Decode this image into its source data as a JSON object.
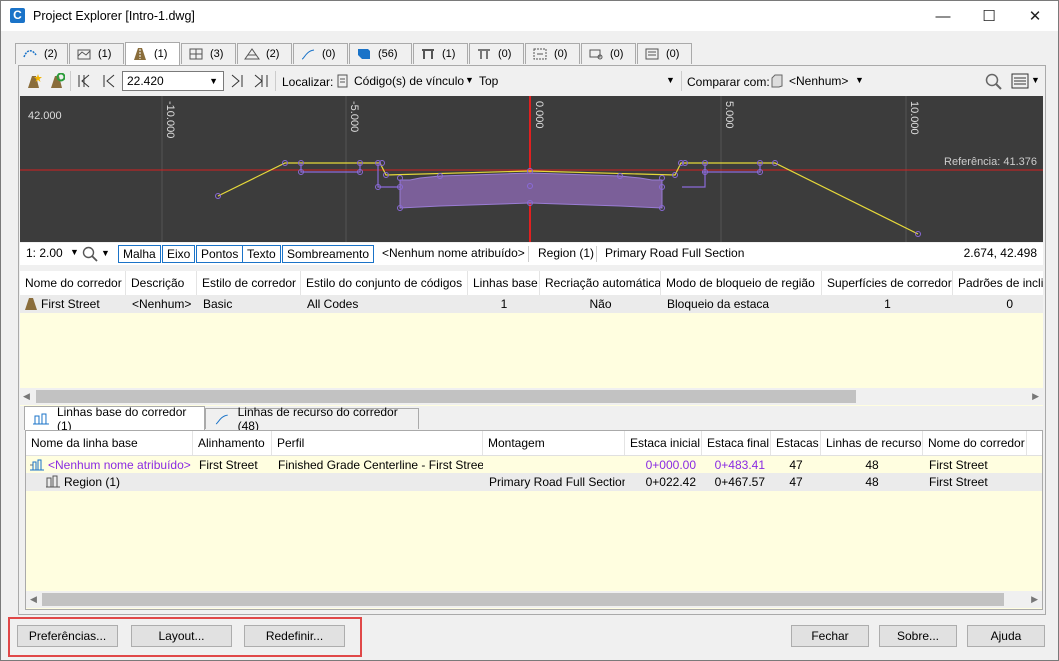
{
  "window": {
    "title": "Project Explorer [Intro-1.dwg]",
    "app_icon": "C"
  },
  "tabs": [
    {
      "icon": "alignment-icon",
      "count": "(2)"
    },
    {
      "icon": "profile-view-icon",
      "count": "(1)"
    },
    {
      "icon": "corridor-icon",
      "count": "(1)"
    },
    {
      "icon": "assembly-icon",
      "count": "(3)"
    },
    {
      "icon": "surface-icon",
      "count": "(2)"
    },
    {
      "icon": "feature-line-icon",
      "count": "(0)"
    },
    {
      "icon": "point-icon",
      "count": "(56)"
    },
    {
      "icon": "pipe-network-icon",
      "count": "(1)"
    },
    {
      "icon": "pressure-network-icon",
      "count": "(0)"
    },
    {
      "icon": "sample-line-icon",
      "count": "(0)"
    },
    {
      "icon": "parcel-icon",
      "count": "(0)"
    },
    {
      "icon": "intersection-icon",
      "count": "(0)"
    }
  ],
  "toolbar": {
    "station": "22.420",
    "localizar_label": "Localizar:",
    "localizar_value": "Código(s) de vínculo",
    "top_value": "Top",
    "comparar_label": "Comparar com:",
    "comparar_value": "<Nenhum>"
  },
  "canvas": {
    "left_label": "42.000",
    "ticks": [
      "-10.000",
      "-5.000",
      "0.000",
      "5.000",
      "10.000"
    ],
    "referencia": "Referência: 41.376"
  },
  "viewbar": {
    "scale": "1: 2.00",
    "toggles": [
      "Malha",
      "Eixo",
      "Pontos",
      "Texto",
      "Sombreamento"
    ],
    "name": "<Nenhum nome atribuído>",
    "region": "Region (1)",
    "section": "Primary Road Full Section",
    "coords": "2.674, 42.498"
  },
  "corridor_grid": {
    "headers": [
      "Nome do corredor",
      "Descrição",
      "Estilo de corredor",
      "Estilo do conjunto de códigos",
      "Linhas base",
      "Recriação automática",
      "Modo de bloqueio de região",
      "Superfícies de corredor",
      "Padrões de inclin"
    ],
    "rows": [
      [
        "First Street",
        "<Nenhum>",
        "Basic",
        "All Codes",
        "1",
        "Não",
        "Bloqueio da estaca",
        "1",
        "0"
      ]
    ]
  },
  "subtabs": [
    {
      "label": "Linhas base do corredor (1)"
    },
    {
      "label": "Linhas de recurso do corredor (48)"
    }
  ],
  "baseline_grid": {
    "headers": [
      "Nome da linha base",
      "Alinhamento",
      "Perfil",
      "Montagem",
      "Estaca inicial",
      "Estaca final",
      "Estacas",
      "Linhas de recurso",
      "Nome do corredor"
    ],
    "rows": [
      [
        "<Nenhum nome atribuído>",
        "First Street",
        "Finished Grade Centerline - First Street",
        "",
        "0+000.00",
        "0+483.41",
        "47",
        "48",
        "First Street"
      ],
      [
        "Region (1)",
        "",
        "",
        "Primary Road Full Section",
        "0+022.42",
        "0+467.57",
        "47",
        "48",
        "First Street"
      ]
    ]
  },
  "footer": {
    "preferencias": "Preferências...",
    "layout": "Layout...",
    "redefinir": "Redefinir...",
    "fechar": "Fechar",
    "sobre": "Sobre...",
    "ajuda": "Ajuda"
  },
  "colors": {
    "accent_blue": "#1a73c8",
    "highlight_red": "#e04848",
    "purple": "#8a2be2",
    "yellow_row": "#fffee0"
  }
}
